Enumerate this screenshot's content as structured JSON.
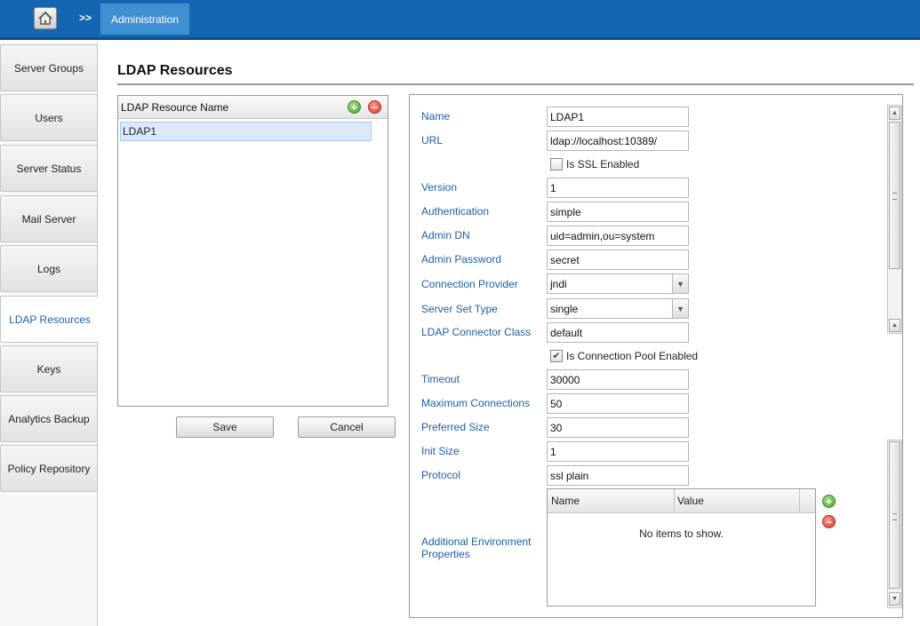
{
  "header": {
    "home_icon": "home-icon",
    "separator": ">>",
    "breadcrumb": "Administration"
  },
  "sidebar": {
    "items": [
      {
        "label": "Server Groups",
        "active": false
      },
      {
        "label": "Users",
        "active": false
      },
      {
        "label": "Server Status",
        "active": false
      },
      {
        "label": "Mail Server",
        "active": false
      },
      {
        "label": "Logs",
        "active": false
      },
      {
        "label": "LDAP Resources",
        "active": true
      },
      {
        "label": "Keys",
        "active": false
      },
      {
        "label": "Analytics Backup",
        "active": false
      },
      {
        "label": "Policy Repository",
        "active": false
      }
    ]
  },
  "main": {
    "title": "LDAP Resources",
    "list": {
      "header": "LDAP Resource Name",
      "items": [
        "LDAP1"
      ]
    },
    "save_label": "Save",
    "cancel_label": "Cancel"
  },
  "form": {
    "name": {
      "label": "Name",
      "value": "LDAP1"
    },
    "url": {
      "label": "URL",
      "value": "ldap://localhost:10389/"
    },
    "ssl": {
      "label": "Is SSL Enabled",
      "checked": false
    },
    "version": {
      "label": "Version",
      "value": "1"
    },
    "authentication": {
      "label": "Authentication",
      "value": "simple"
    },
    "admin_dn": {
      "label": "Admin DN",
      "value": "uid=admin,ou=system"
    },
    "admin_password": {
      "label": "Admin Password",
      "value": "secret"
    },
    "connection_provider": {
      "label": "Connection Provider",
      "value": "jndi"
    },
    "server_set_type": {
      "label": "Server Set Type",
      "value": "single"
    },
    "connector_class": {
      "label": "LDAP Connector Class",
      "value": "default"
    },
    "pool_enabled": {
      "label": "Is Connection Pool Enabled",
      "checked": true
    },
    "timeout": {
      "label": "Timeout",
      "value": "30000"
    },
    "max_connections": {
      "label": "Maximum Connections",
      "value": "50"
    },
    "preferred_size": {
      "label": "Preferred Size",
      "value": "30"
    },
    "init_size": {
      "label": "Init Size",
      "value": "1"
    },
    "protocol": {
      "label": "Protocol",
      "value": "ssl plain"
    },
    "env_properties": {
      "label": "Additional Environment Properties",
      "columns": [
        "Name",
        "Value"
      ],
      "empty_text": "No items to show."
    }
  },
  "colors": {
    "topbar": "#1566b0",
    "breadcrumb_tab": "#3f8fd3",
    "label_blue": "#1e5fa6",
    "selected_row": "#dce9f8"
  }
}
